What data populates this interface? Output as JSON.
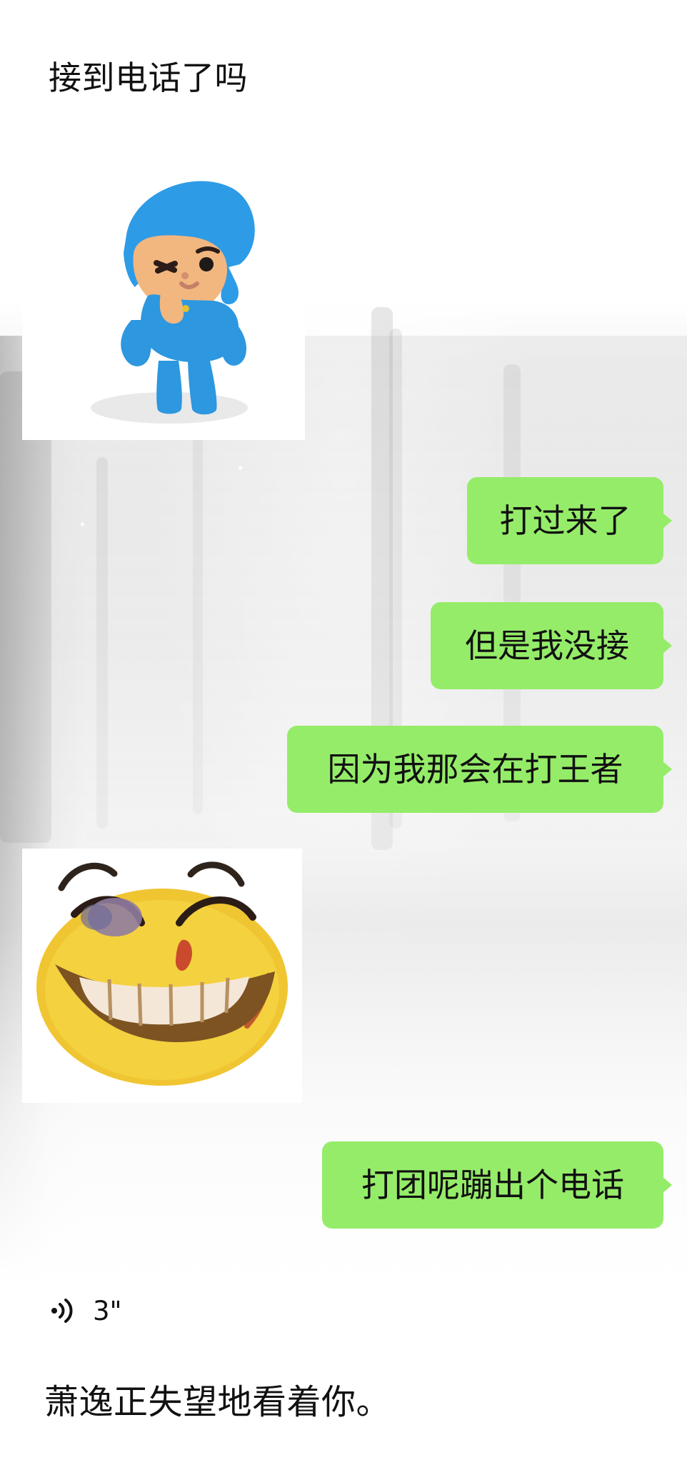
{
  "conversation": {
    "messages": {
      "incoming_1": "接到电话了吗",
      "outgoing_1": "打过来了",
      "outgoing_2": "但是我没接",
      "outgoing_3": "因为我那会在打王者",
      "outgoing_4": "打团呢蹦出个电话",
      "voice_duration": "3\"",
      "final_text": "萧逸正失望地看着你。"
    },
    "stickers": {
      "sticker_1": "pocoyo-thinking-sticker",
      "sticker_2": "grinning-bruised-face-sticker"
    },
    "icons": {
      "voice": "voice-icon"
    },
    "colors": {
      "outgoing_bubble": "#95ec69",
      "text": "#111111",
      "background": "#ffffff"
    }
  }
}
